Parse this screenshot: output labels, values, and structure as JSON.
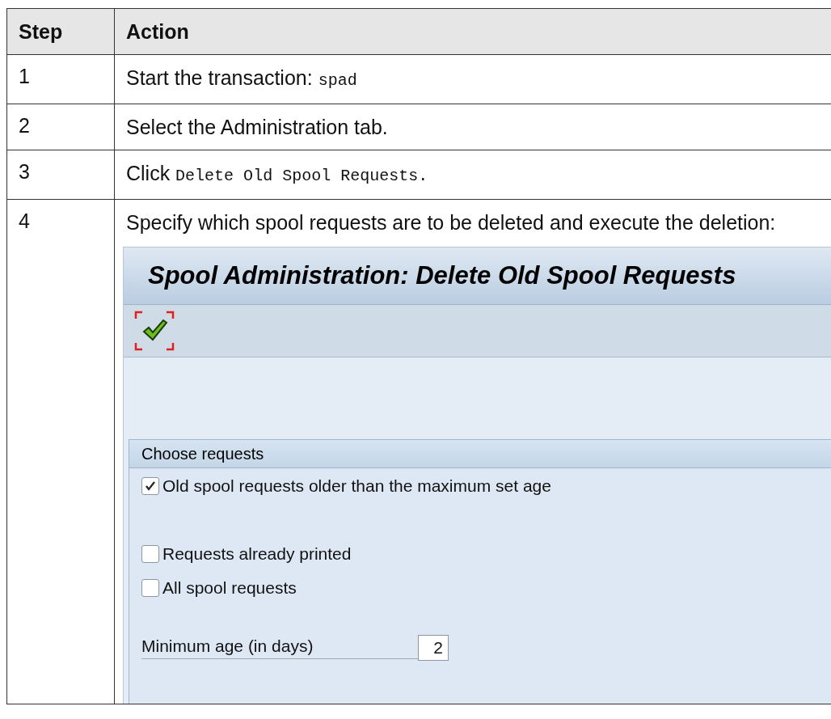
{
  "table": {
    "columns": [
      "Step",
      "Action"
    ],
    "rows": [
      {
        "step": "1",
        "action": [
          {
            "kind": "text",
            "text": "Start the transaction: "
          },
          {
            "kind": "code",
            "text": "spad"
          }
        ]
      },
      {
        "step": "2",
        "action": [
          {
            "kind": "text",
            "text": "Select the Administration tab."
          }
        ]
      },
      {
        "step": "3",
        "action": [
          {
            "kind": "text",
            "text": "Click "
          },
          {
            "kind": "code",
            "text": "Delete Old Spool Requests."
          }
        ]
      },
      {
        "step": "4",
        "action": [
          {
            "kind": "text",
            "text": "Specify which spool requests are to be deleted and execute the deletion:"
          }
        ],
        "screen": {
          "title": "Spool Administration: Delete Old Spool Requests",
          "group": {
            "title": "Choose requests",
            "options": [
              {
                "label": "Old spool requests older than the maximum set age",
                "checked": true
              },
              {
                "label": "Requests already printed",
                "checked": false
              },
              {
                "label": "All spool requests",
                "checked": false
              }
            ],
            "field": {
              "label": "Minimum age (in days)",
              "value": "2"
            }
          }
        }
      }
    ]
  }
}
